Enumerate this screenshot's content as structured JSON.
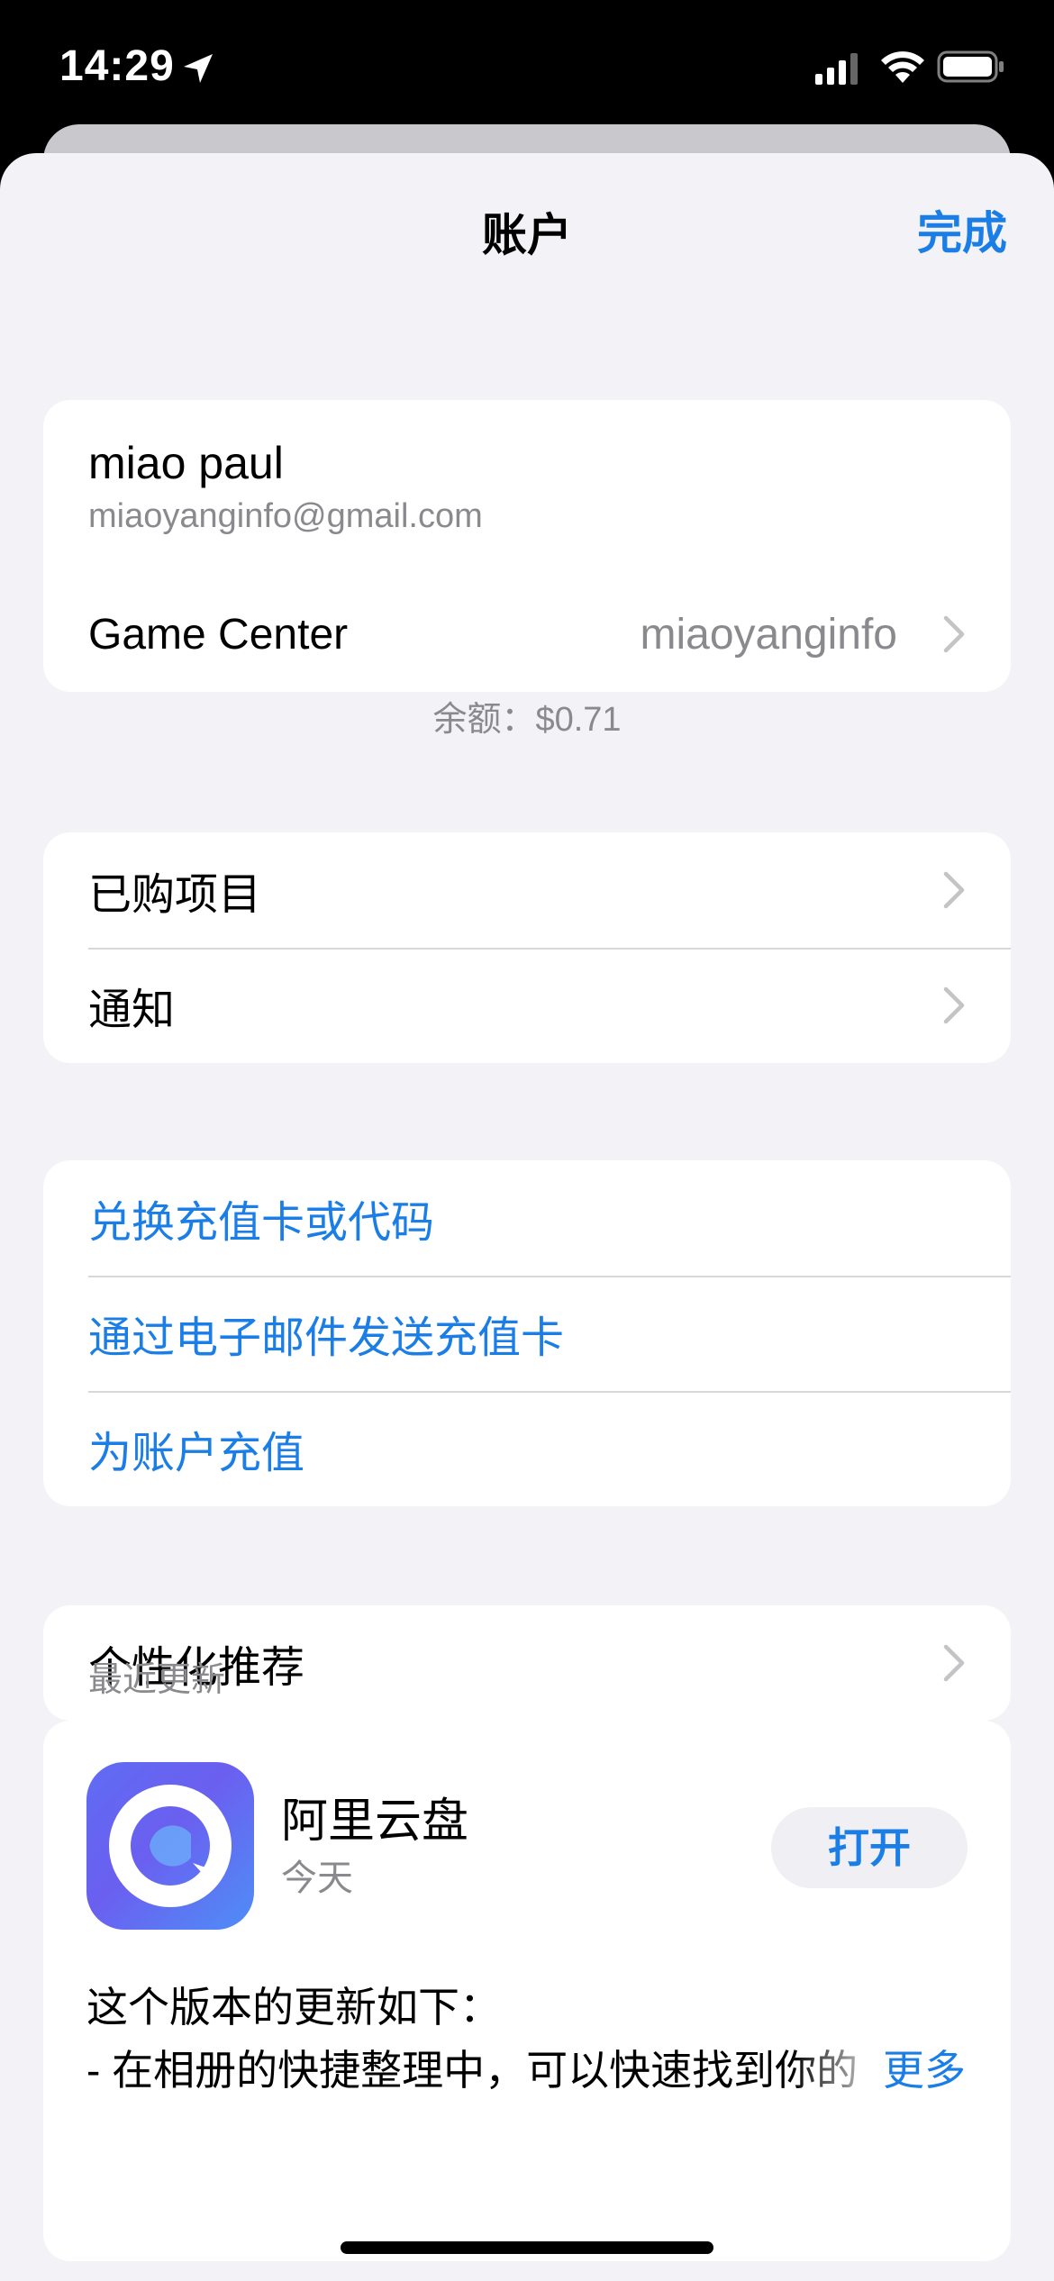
{
  "status_bar": {
    "time": "14:29"
  },
  "nav": {
    "title": "账户",
    "done_label": "完成"
  },
  "account": {
    "name": "miao paul",
    "email": "miaoyanginfo@gmail.com",
    "game_center_label": "Game Center",
    "game_center_value": "miaoyanginfo",
    "balance": "余额：$0.71"
  },
  "menu1": {
    "purchased": "已购项目",
    "notifications": "通知"
  },
  "gift_menu": {
    "redeem": "兑换充值卡或代码",
    "send_gift": "通过电子邮件发送充值卡",
    "add_funds": "为账户充值"
  },
  "personalized": {
    "label": "个性化推荐"
  },
  "recent_updates": {
    "header": "最近更新",
    "app_name": "阿里云盘",
    "app_date": "今天",
    "open_label": "打开",
    "notes_line1": "这个版本的更新如下：",
    "notes_line2": "- 在相册的快捷整理中，可以快速找到你的",
    "more_label": "更多"
  },
  "colors": {
    "accent": "#1a7ee6",
    "secondary_text": "#8a8a8e",
    "background": "#f2f2f7"
  }
}
